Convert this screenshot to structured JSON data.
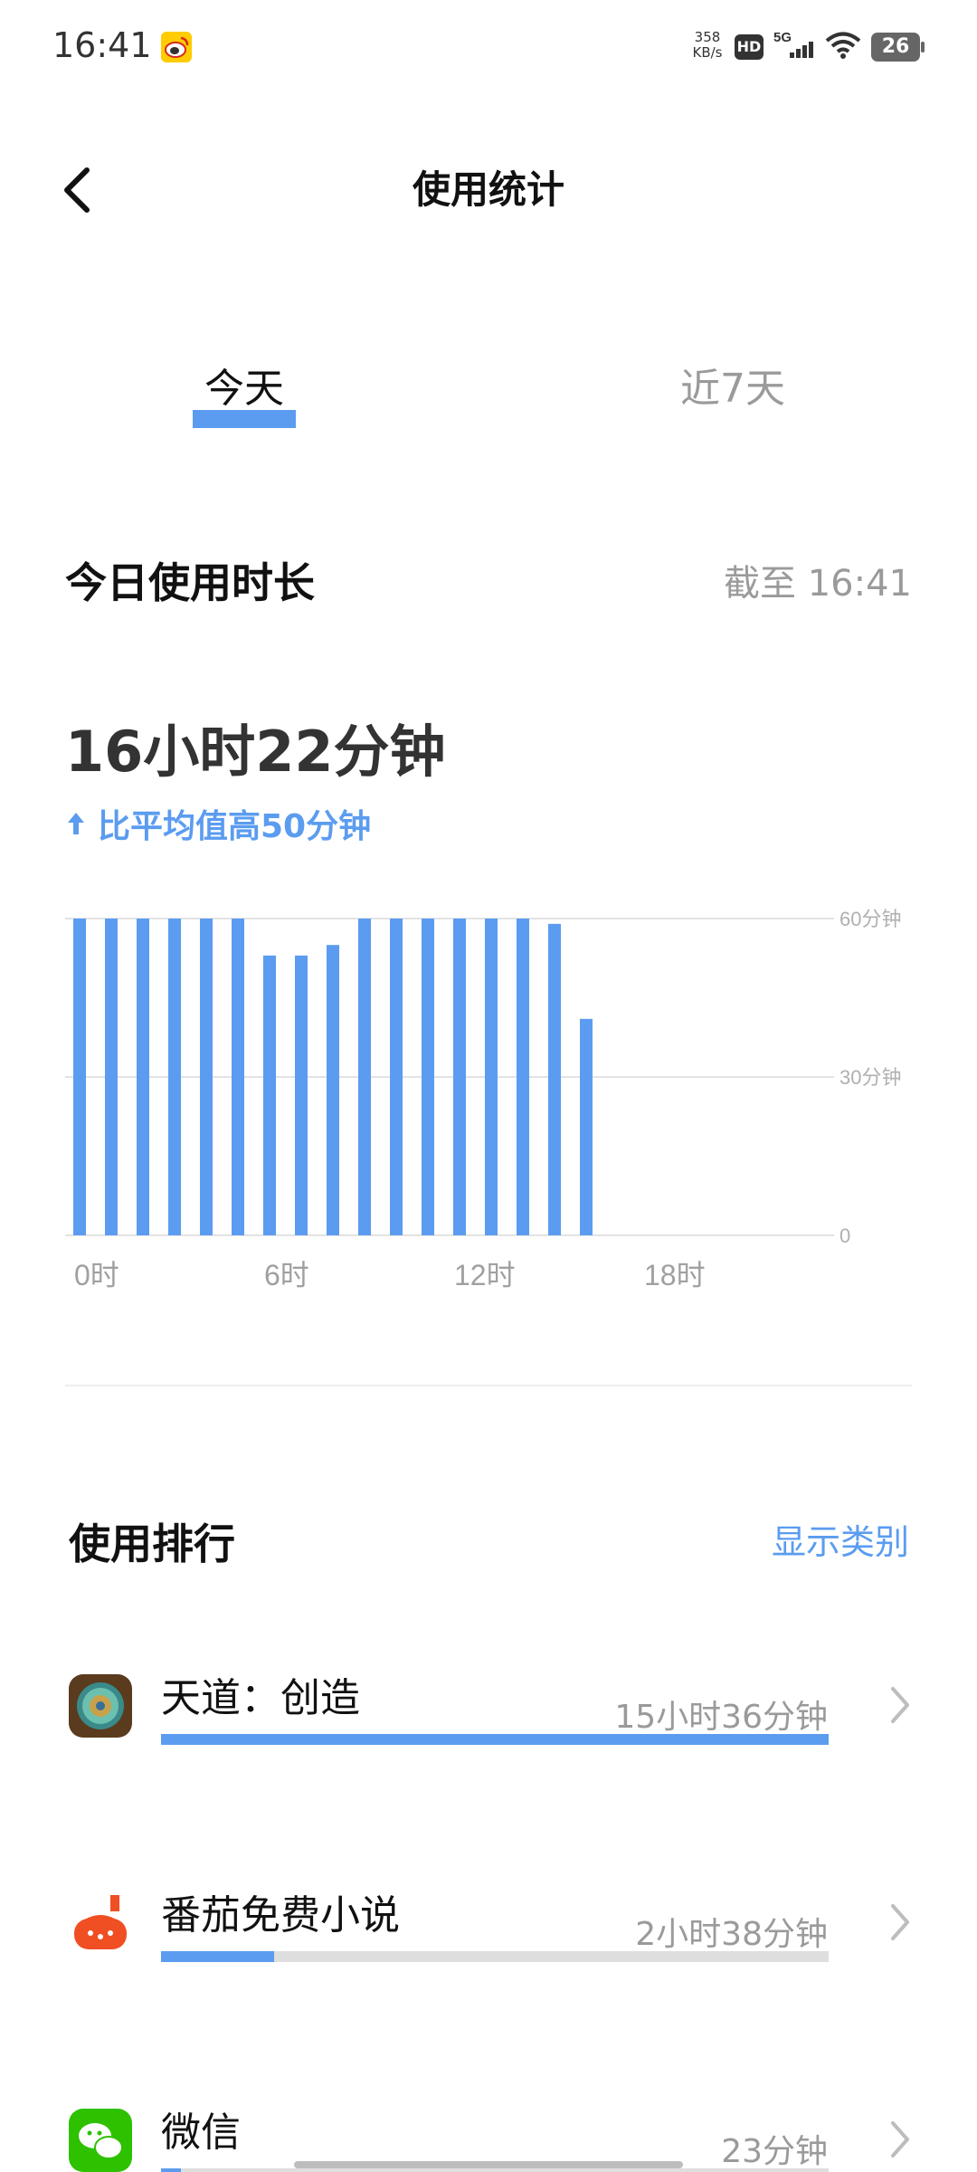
{
  "status_bar": {
    "time": "16:41",
    "notification_icon": "weibo-icon",
    "net_speed_value": "358",
    "net_speed_unit": "KB/s",
    "hd_label": "HD",
    "network_label": "5G",
    "battery_level": "26"
  },
  "header": {
    "back_icon": "chevron-left-icon",
    "title": "使用统计"
  },
  "tabs": [
    {
      "label": "今天",
      "selected": true
    },
    {
      "label": "近7天",
      "selected": false
    }
  ],
  "usage": {
    "section_title": "今日使用时长",
    "as_of": "截至 16:41",
    "total": "16小时22分钟",
    "compare_text": "比平均值高50分钟"
  },
  "chart_data": {
    "type": "bar",
    "categories": [
      "0",
      "1",
      "2",
      "3",
      "4",
      "5",
      "6",
      "7",
      "8",
      "9",
      "10",
      "11",
      "12",
      "13",
      "14",
      "15",
      "16",
      "17",
      "18",
      "19",
      "20",
      "21",
      "22",
      "23"
    ],
    "values": [
      60,
      60,
      60,
      60,
      60,
      60,
      53,
      53,
      55,
      60,
      60,
      60,
      60,
      60,
      60,
      59,
      41,
      0,
      0,
      0,
      0,
      0,
      0,
      0
    ],
    "x_tick_labels": [
      {
        "index": 0,
        "label": "0时"
      },
      {
        "index": 6,
        "label": "6时"
      },
      {
        "index": 12,
        "label": "12时"
      },
      {
        "index": 18,
        "label": "18时"
      }
    ],
    "y_tick_labels": [
      {
        "value": 60,
        "label": "60分钟"
      },
      {
        "value": 30,
        "label": "30分钟"
      },
      {
        "value": 0,
        "label": "0"
      }
    ],
    "ylim": [
      0,
      60
    ],
    "grid": true,
    "bar_color": "#5b9cf0"
  },
  "ranking": {
    "title": "使用排行",
    "show_category_label": "显示类别",
    "apps": [
      {
        "name": "天道：创造",
        "duration": "15小时36分钟",
        "fraction": 1.0,
        "icon": "tiandao-app-icon"
      },
      {
        "name": "番茄免费小说",
        "duration": "2小时38分钟",
        "fraction": 0.17,
        "icon": "tomato-novel-icon"
      },
      {
        "name": "微信",
        "duration": "23分钟",
        "fraction": 0.03,
        "icon": "wechat-icon"
      }
    ]
  },
  "colors": {
    "accent": "#5b9cf0",
    "muted_text": "#9a9a9a",
    "track": "#dedede"
  }
}
